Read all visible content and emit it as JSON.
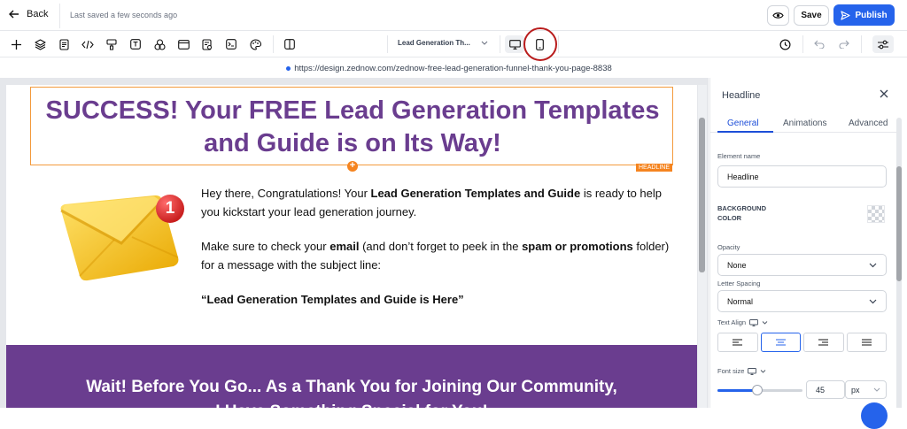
{
  "header": {
    "back_label": "Back",
    "saved_status": "Last saved a few seconds ago",
    "save_label": "Save",
    "publish_label": "Publish"
  },
  "toolbar": {
    "tools": [
      "plus-icon",
      "layers-icon",
      "page-icon",
      "code-icon",
      "paint-icon",
      "text-icon",
      "shapes-icon",
      "window-icon",
      "form-icon",
      "terminal-icon",
      "palette-icon",
      "columns-icon"
    ],
    "page_select": "Lead Generation Th...",
    "devices": [
      "desktop-icon",
      "mobile-icon"
    ],
    "active_device": "desktop"
  },
  "url_bar": {
    "url": "https://design.zednow.com/zednow-free-lead-generation-funnel-thank-you-page-8838"
  },
  "canvas": {
    "headline_line1": "SUCCESS! Your FREE Lead Generation Templates",
    "headline_line2": "and Guide is on Its Way!",
    "headline_tag": "HEADLINE",
    "notification_count": "1",
    "p1_a": "Hey there, Congratulations! Your ",
    "p1_bold": "Lead Generation Templates and Guide",
    "p1_b": " is ready to help you kickstart your lead generation journey.",
    "p2_a": "Make sure to check your ",
    "p2_bold1": "email",
    "p2_b": " (and don’t forget to peek in the ",
    "p2_bold2": "spam or promotions",
    "p2_c": " folder) for a message with the subject line:",
    "p3_bold": "“Lead Generation Templates and Guide is Here”",
    "banner_line1": "Wait! Before You Go... As a Thank You for Joining Our Community,",
    "banner_line2": "I Have Something Special for You!"
  },
  "panel": {
    "title": "Headline",
    "tabs": [
      "General",
      "Animations",
      "Advanced"
    ],
    "active_tab": "General",
    "element_name_label": "Element name",
    "element_name_value": "Headline",
    "bg_label_1": "BACKGROUND",
    "bg_label_2": "COLOR",
    "opacity_label": "Opacity",
    "opacity_value": "None",
    "letter_spacing_label": "Letter Spacing",
    "letter_spacing_value": "Normal",
    "text_align_label": "Text Align",
    "text_align_active": "center",
    "font_size_label": "Font size",
    "font_size_value": "45",
    "font_size_unit": "px",
    "font_size_slider_level": 0.47
  },
  "colors": {
    "accent": "#2563eb",
    "headline_purple": "#6a3d8f",
    "selection_orange": "#f5841f"
  }
}
